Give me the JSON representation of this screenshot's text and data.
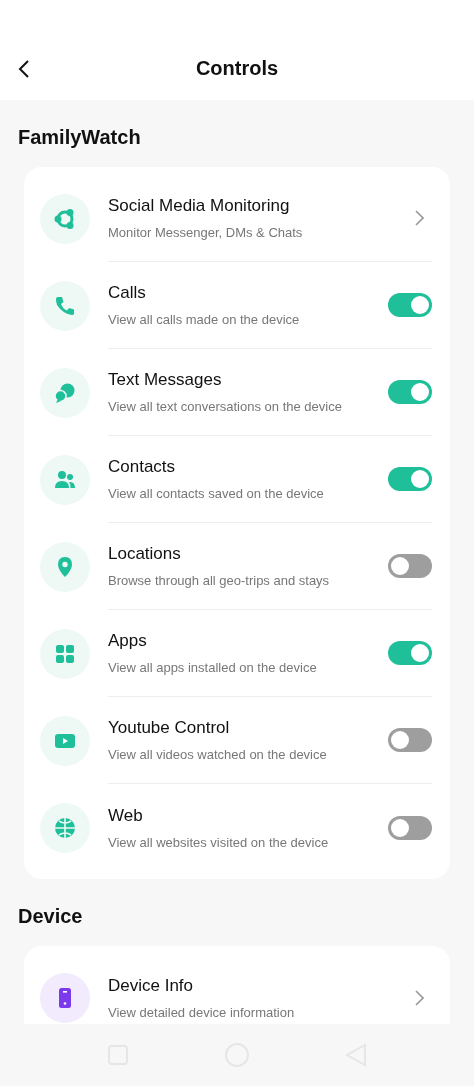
{
  "header": {
    "title": "Controls"
  },
  "sections": [
    {
      "title": "FamilyWatch",
      "items": [
        {
          "kind": "link",
          "title": "Social Media Monitoring",
          "subtitle": "Monitor Messenger, DMs & Chats"
        },
        {
          "kind": "toggle",
          "title": "Calls",
          "subtitle": "View all calls made on the device",
          "on": true
        },
        {
          "kind": "toggle",
          "title": "Text Messages",
          "subtitle": "View all text conversations on the device",
          "on": true
        },
        {
          "kind": "toggle",
          "title": "Contacts",
          "subtitle": "View all contacts saved on the device",
          "on": true
        },
        {
          "kind": "toggle",
          "title": "Locations",
          "subtitle": "Browse through all geo-trips and stays",
          "on": false
        },
        {
          "kind": "toggle",
          "title": "Apps",
          "subtitle": "View all apps installed on the device",
          "on": true
        },
        {
          "kind": "toggle",
          "title": "Youtube Control",
          "subtitle": "View all videos watched on the device",
          "on": false
        },
        {
          "kind": "toggle",
          "title": "Web",
          "subtitle": "View all websites visited on the device",
          "on": false
        }
      ]
    },
    {
      "title": "Device",
      "items": [
        {
          "kind": "link",
          "title": "Device Info",
          "subtitle": "View detailed device information"
        }
      ]
    }
  ]
}
